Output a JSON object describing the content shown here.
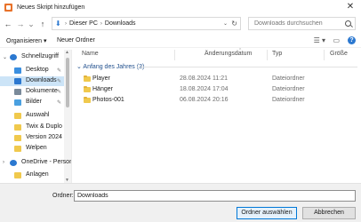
{
  "window": {
    "title": "Neues Skript hinzufügen",
    "close_glyph": "✕"
  },
  "nav": {
    "back_glyph": "←",
    "forward_glyph": "→",
    "recent_glyph": "⌄",
    "up_glyph": "↑",
    "breadcrumb": [
      "Dieser PC",
      "Downloads"
    ],
    "breadcrumb_separator": "›",
    "search_placeholder": "Downloads durchsuchen",
    "refresh_glyph": "↻",
    "dropdown_glyph": "⌄"
  },
  "commands": {
    "organize": "Organisieren ▾",
    "new_folder": "Neuer Ordner",
    "view_glyph": "☰ ▾",
    "help_glyph": "?"
  },
  "sidebar": {
    "items": [
      {
        "label": "Schnellzugriff",
        "icon": "star-icon",
        "color": "#2b78d0",
        "expand": "⌄",
        "pinned": false,
        "selected": false
      },
      {
        "label": "Desktop",
        "icon": "desktop-icon",
        "color": "#3a8fe0",
        "pinned": true,
        "selected": false
      },
      {
        "label": "Downloads",
        "icon": "download-icon",
        "color": "#2b78d0",
        "pinned": true,
        "selected": true
      },
      {
        "label": "Dokumente",
        "icon": "documents-icon",
        "color": "#7a8a9a",
        "pinned": true,
        "selected": false
      },
      {
        "label": "Bilder",
        "icon": "pictures-icon",
        "color": "#4aa0e0",
        "pinned": true,
        "selected": false
      },
      {
        "label": "Auswahl",
        "icon": "folder-icon",
        "color": "#f0c94d",
        "pinned": false,
        "selected": false
      },
      {
        "label": "Twix & Duplo",
        "icon": "folder-icon",
        "color": "#f0c94d",
        "pinned": false,
        "selected": false
      },
      {
        "label": "Version 2024",
        "icon": "folder-icon",
        "color": "#f0c94d",
        "pinned": false,
        "selected": false
      },
      {
        "label": "Welpen",
        "icon": "folder-icon",
        "color": "#f0c94d",
        "pinned": false,
        "selected": false
      },
      {
        "label": "OneDrive - Person",
        "icon": "onedrive-icon",
        "color": "#2b78d0",
        "expand": "›",
        "pinned": false,
        "selected": false
      },
      {
        "label": "Anlagen",
        "icon": "folder-icon",
        "color": "#f0c94d",
        "pinned": false,
        "selected": false
      },
      {
        "label": "",
        "icon": "folder-icon",
        "color": "#f0c94d",
        "pinned": false,
        "selected": false
      }
    ],
    "pin_glyph": "📌"
  },
  "files": {
    "columns": {
      "name": "Name",
      "date": "Änderungsdatum",
      "type": "Typ",
      "size": "Größe"
    },
    "group_label": "⌄ Anfang des Jahres (3)",
    "rows": [
      {
        "name": "Player",
        "date": "28.08.2024 11:21",
        "type": "Dateiordner"
      },
      {
        "name": "Hänger",
        "date": "18.08.2024 17:04",
        "type": "Dateiordner"
      },
      {
        "name": "Photos-001",
        "date": "06.08.2024 20:16",
        "type": "Dateiordner"
      }
    ]
  },
  "footer": {
    "folder_label": "Ordner:",
    "folder_value": "Downloads",
    "select_button": "Ordner auswählen",
    "cancel_button": "Abbrechen"
  },
  "colors": {
    "accent": "#0078d7",
    "selection": "#cce4f7",
    "folder": "#f0c94d"
  }
}
